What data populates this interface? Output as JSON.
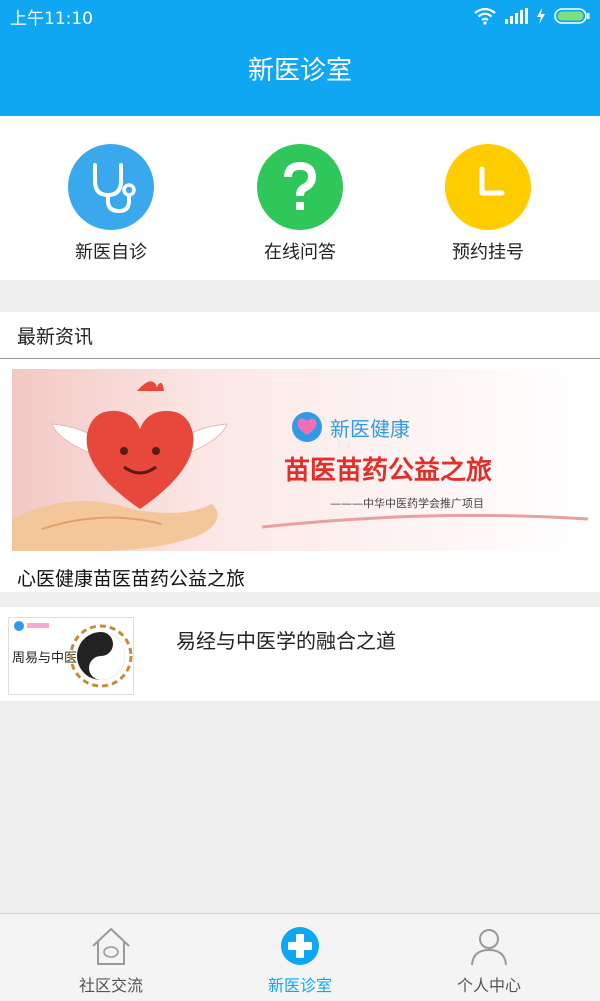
{
  "status": {
    "time": "上午11:10"
  },
  "header": {
    "title": "新医诊室"
  },
  "quick_actions": [
    {
      "label": "新医自诊",
      "icon": "stethoscope-icon",
      "color": "#3aa8ec"
    },
    {
      "label": "在线问答",
      "icon": "question-icon",
      "color": "#2fc65a"
    },
    {
      "label": "预约挂号",
      "icon": "clock-icon",
      "color": "#ffcc00"
    }
  ],
  "news": {
    "section_title": "最新资讯",
    "feature": {
      "banner_brand": "新医健康",
      "banner_headline": "苗医苗药公益之旅",
      "banner_sub": "———中华中医药学会推广项目",
      "caption": "心医健康苗医苗药公益之旅"
    },
    "items": [
      {
        "title": "易经与中医学的融合之道",
        "thumb_text": "周易与中医"
      }
    ]
  },
  "bottom_nav": {
    "tabs": [
      {
        "label": "社区交流",
        "active": false
      },
      {
        "label": "新医诊室",
        "active": true
      },
      {
        "label": "个人中心",
        "active": false
      }
    ],
    "active_color": "#0fa6f2",
    "inactive_color": "#555555"
  }
}
